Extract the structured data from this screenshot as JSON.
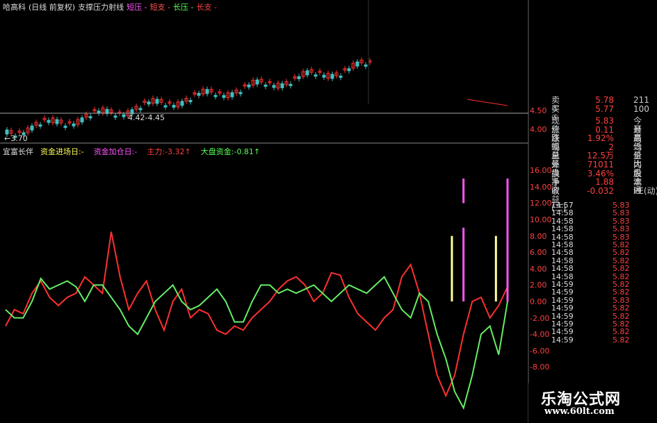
{
  "header": {
    "stock": "哈高科",
    "period": "(日线 前复权)",
    "indicator": "支撑压力射线",
    "labels": [
      {
        "text": "短压 -",
        "color": "#ff55ff"
      },
      {
        "text": "短支 -",
        "color": "#ff5555"
      },
      {
        "text": "长压 -",
        "color": "#55ff55"
      },
      {
        "text": "长支 -",
        "color": "#ff4040"
      }
    ]
  },
  "upper": {
    "low_label": "←3.70",
    "range_label": "4.42-4.45",
    "axis_ticks": [
      "4.50",
      "4.00"
    ]
  },
  "lower": {
    "title": "宜富长伴",
    "items": [
      {
        "text": "资金进场日:-",
        "color": "#ffff55"
      },
      {
        "text": "资金加仓日:-",
        "color": "#ff55ff"
      },
      {
        "text": "主力:-3.32↑",
        "color": "#ff4040"
      },
      {
        "text": "大盘资金:-0.81↑",
        "color": "#55ff55"
      }
    ],
    "axis_ticks": [
      "16.00",
      "14.00",
      "12.00",
      "10.00",
      "8.00",
      "6.00",
      "4.00",
      "2.00",
      "0.00",
      "-2.00",
      "-4.00",
      "-6.00",
      "-8.00"
    ]
  },
  "chart_data": {
    "type": "line",
    "ylim": [
      -12,
      17
    ],
    "series": [
      {
        "name": "主力",
        "color": "#ff3030",
        "values": [
          -3,
          -1,
          -1.5,
          1,
          2.5,
          0.5,
          -0.5,
          0.5,
          1,
          3,
          2,
          1,
          8.5,
          3,
          -1,
          1,
          2.5,
          -1,
          -3.5,
          0,
          1.5,
          -2,
          -1,
          -1.5,
          -3.5,
          -4,
          -3,
          -3.5,
          -2,
          -1,
          0,
          1.5,
          2.5,
          3,
          2,
          0,
          1,
          3.5,
          3.2,
          0.5,
          -1.5,
          -2.5,
          -3.5,
          -2,
          -1,
          3,
          4.5,
          1,
          -4,
          -9,
          -11.5,
          -9,
          -4,
          0,
          0.5,
          -2,
          -0.5,
          1.8
        ]
      },
      {
        "name": "大盘资金",
        "color": "#66ee66",
        "values": [
          -1,
          -2,
          -2,
          0,
          2.8,
          1.5,
          2,
          2.5,
          1.8,
          0,
          2,
          2,
          0.5,
          -1,
          -3,
          -4,
          -2,
          0,
          1,
          2,
          0,
          -1,
          -0.5,
          0.5,
          1.5,
          0,
          -2.5,
          -2.5,
          0,
          2,
          2,
          1,
          1.5,
          1,
          1.5,
          2,
          1,
          0,
          1,
          2,
          1.5,
          1,
          2,
          3,
          1,
          -1,
          -2,
          1,
          0,
          -4,
          -7,
          -11,
          -13,
          -9,
          -4,
          -3,
          -6.5,
          0
        ]
      }
    ],
    "bars": [
      {
        "x_index": 51,
        "from": 0,
        "to": 8,
        "color": "#ffff99"
      },
      {
        "x_index": 52,
        "from": 0,
        "to": 9,
        "color": "#ff55ff"
      },
      {
        "x_index": 52,
        "from": 12,
        "to": 15,
        "color": "#ff55ff"
      },
      {
        "x_index": 56,
        "from": 0,
        "to": 8,
        "color": "#ffff99"
      },
      {
        "x_index": 57,
        "from": 0,
        "to": 15,
        "color": "#ff55ff"
      }
    ]
  },
  "quote": {
    "top_rows": [
      {
        "label": "卖⑤",
        "value": "5.78",
        "extra": "211"
      },
      {
        "label": "买⑤",
        "value": "5.77",
        "extra": "100"
      }
    ],
    "rows": [
      {
        "label": "现价",
        "value": "5.83",
        "extra": "今开"
      },
      {
        "label": "涨跌",
        "value": "0.11",
        "extra": "最高"
      },
      {
        "label": "涨幅",
        "value": "1.92%",
        "extra": "最低"
      },
      {
        "label": "现量",
        "value": "2",
        "extra": "均价"
      },
      {
        "label": "总量",
        "value": "12.5万",
        "extra": "量比"
      },
      {
        "label": "外盘",
        "value": "71011",
        "extra": "内盘"
      },
      {
        "label": "换手",
        "value": "3.46%",
        "extra": "股本"
      },
      {
        "label": "净资",
        "value": "1.88",
        "extra": "流通"
      },
      {
        "label": "收益(三)",
        "value": "-0.032",
        "extra": "PE(动)"
      }
    ],
    "ticks": [
      {
        "time": "14:57",
        "price": "5.83"
      },
      {
        "time": "14:58",
        "price": "5.83"
      },
      {
        "time": "14:58",
        "price": "5.83"
      },
      {
        "time": "14:58",
        "price": "5.83"
      },
      {
        "time": "14:58",
        "price": "5.83"
      },
      {
        "time": "14:58",
        "price": "5.82"
      },
      {
        "time": "14:58",
        "price": "5.82"
      },
      {
        "time": "14:58",
        "price": "5.82"
      },
      {
        "time": "14:58",
        "price": "5.82"
      },
      {
        "time": "14:58",
        "price": "5.82"
      },
      {
        "time": "14:59",
        "price": "5.82"
      },
      {
        "time": "14:59",
        "price": "5.82"
      },
      {
        "time": "14:59",
        "price": "5.83"
      },
      {
        "time": "14:59",
        "price": "5.82"
      },
      {
        "time": "14:59",
        "price": "5.82"
      },
      {
        "time": "14:59",
        "price": "5.82"
      },
      {
        "time": "14:59",
        "price": "5.82"
      },
      {
        "time": "14:59",
        "price": "5.82"
      }
    ]
  },
  "watermark": {
    "title": "乐淘公式网",
    "url": "www.60lt.com"
  }
}
